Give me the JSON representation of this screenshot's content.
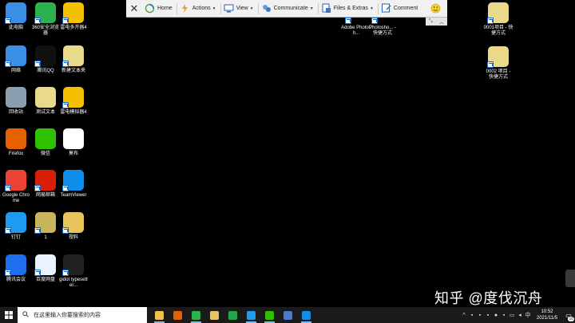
{
  "desktop_icons": [
    {
      "label": "此电脑",
      "icon": "this-pc-icon",
      "color": "#3a8ee6"
    },
    {
      "label": "360安全浏览器",
      "icon": "360-browser-icon",
      "color": "#2bb24c"
    },
    {
      "label": "雷电多开器4",
      "icon": "ldmultiplayer-icon",
      "color": "#f5c000"
    },
    {
      "label": "网络",
      "icon": "network-icon",
      "color": "#3a8ee6"
    },
    {
      "label": "腾讯QQ",
      "icon": "qq-icon",
      "color": "#111111"
    },
    {
      "label": "新建文本夹",
      "icon": "text-file-icon",
      "color": "#e9d98a"
    },
    {
      "label": "回收站",
      "icon": "recycle-bin-icon",
      "color": "#8aa0b0"
    },
    {
      "label": "测试文本",
      "icon": "text-file-icon",
      "color": "#e9d98a"
    },
    {
      "label": "雷电模拟器4",
      "icon": "ldplayer-icon",
      "color": "#f5c000"
    },
    {
      "label": "Firefox",
      "icon": "firefox-icon",
      "color": "#e66000"
    },
    {
      "label": "微信",
      "icon": "wechat-icon",
      "color": "#2dc100"
    },
    {
      "label": "莫布",
      "icon": "mobu-icon",
      "color": "#ffffff"
    },
    {
      "label": "Google Chrome",
      "icon": "chrome-icon",
      "color": "#ea4335"
    },
    {
      "label": "网易邮箱",
      "icon": "netease-mail-icon",
      "color": "#d81e06"
    },
    {
      "label": "TeamViewer",
      "icon": "teamviewer-icon",
      "color": "#0e8ee9"
    },
    {
      "label": "钉钉",
      "icon": "dingtalk-icon",
      "color": "#1e9bf0"
    },
    {
      "label": "1",
      "icon": "photo-file-icon",
      "color": "#c8b45a"
    },
    {
      "label": "授料",
      "icon": "folder-icon",
      "color": "#e8c45c"
    },
    {
      "label": "腾讯会议",
      "icon": "tencent-meeting-icon",
      "color": "#1e6ff0"
    },
    {
      "label": "百度网盘",
      "icon": "baidu-netdisk-icon",
      "color": "#eaf2ff"
    },
    {
      "label": "gidot typesetter...",
      "icon": "gidot-typesetter-icon",
      "color": "#222222"
    },
    {
      "label": "Adobe Photosh...",
      "icon": "photoshop-shortcut-icon",
      "color": "#000000"
    },
    {
      "label": "Photosho... - 快捷方式",
      "icon": "photoshop-shortcut-icon",
      "color": "#000000"
    },
    {
      "label": "0001项目 - 快捷方式",
      "icon": "file-shortcut-icon",
      "color": "#e9d98a"
    },
    {
      "label": "0002 项目 - 快捷方式",
      "icon": "file-shortcut-icon",
      "color": "#e9d98a"
    }
  ],
  "remote_toolbar": {
    "items": [
      {
        "label": "Home",
        "icon": "home-icon",
        "has_menu": false
      },
      {
        "label": "Actions",
        "icon": "actions-icon",
        "has_menu": true
      },
      {
        "label": "View",
        "icon": "view-icon",
        "has_menu": true
      },
      {
        "label": "Communicate",
        "icon": "communicate-icon",
        "has_menu": true
      },
      {
        "label": "Files & Extras",
        "icon": "files-icon",
        "has_menu": true
      },
      {
        "label": "Comment",
        "icon": "comment-icon",
        "has_menu": false
      }
    ]
  },
  "watermark": "知乎 @度伐沉舟",
  "taskbar": {
    "search_placeholder": "在这里输入你要搜索的内容",
    "pinned_apps": [
      {
        "icon": "file-explorer-icon",
        "color": "#f2c14e"
      },
      {
        "icon": "firefox-icon",
        "color": "#e66000"
      },
      {
        "icon": "360-browser-icon",
        "color": "#2bb24c"
      },
      {
        "icon": "folder-icon",
        "color": "#e8c45c"
      },
      {
        "icon": "green-app-icon",
        "color": "#22a84a"
      },
      {
        "icon": "dingtalk-icon",
        "color": "#1e9bf0"
      },
      {
        "icon": "wechat-icon",
        "color": "#2dc100"
      },
      {
        "icon": "text-editor-icon",
        "color": "#4a7bd0"
      },
      {
        "icon": "teamviewer-icon",
        "color": "#0e8ee9"
      }
    ],
    "time": "10:52",
    "date": "2021/11/5",
    "notification_count": "10"
  }
}
